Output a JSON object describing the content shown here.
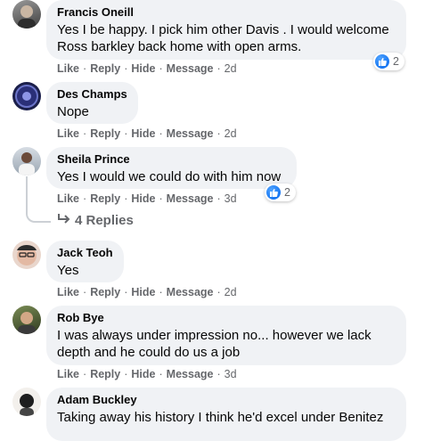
{
  "actions": {
    "like": "Like",
    "reply": "Reply",
    "hide": "Hide",
    "message": "Message",
    "sep": "·"
  },
  "comments": [
    {
      "name": "Francis Oneill",
      "text": "Yes I be happy. I pick him other Davis . I would welcome Ross barkley back home with open arms.",
      "time": "2d",
      "reactions": "2"
    },
    {
      "name": "Des Champs",
      "text": "Nope",
      "time": "2d"
    },
    {
      "name": "Sheila Prince",
      "text": "Yes I would we could do with him now",
      "time": "3d",
      "reactions": "2",
      "replies": "4 Replies"
    },
    {
      "name": "Jack Teoh",
      "text": "Yes",
      "time": "2d"
    },
    {
      "name": "Rob Bye",
      "text": "I was always under impression no... however we lack depth and he could do us a job",
      "time": "3d"
    },
    {
      "name": "Adam Buckley",
      "text": "Taking away his history I think he'd excel under Benitez"
    }
  ]
}
